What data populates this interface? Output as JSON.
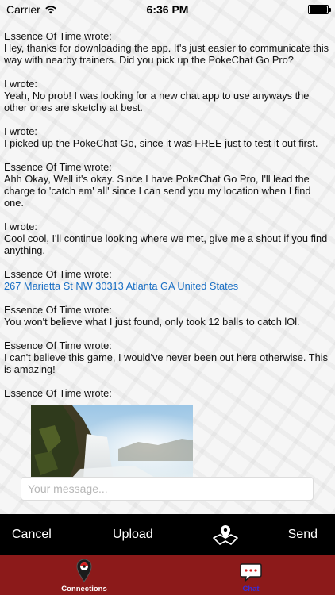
{
  "status_bar": {
    "carrier": "Carrier",
    "time": "6:36 PM"
  },
  "messages": [
    {
      "sender": "Essence Of Time wrote:",
      "text": "Hey, thanks for downloading the app. It's just easier to communicate this way with nearby trainers. Did you pick up the PokeChat Go Pro?"
    },
    {
      "sender": "I wrote:",
      "text": "Yeah, No prob! I was looking for a new chat app to use anyways the other ones are sketchy at best."
    },
    {
      "sender": "I wrote:",
      "text": "I picked up the PokeChat Go, since it was FREE just to test it out first."
    },
    {
      "sender": "Essence Of Time wrote:",
      "text": "Ahh Okay, Well it's okay. Since I have PokeChat Go Pro, I'll lead the charge to 'catch em' all' since I can send you my location when I find one."
    },
    {
      "sender": "I wrote:",
      "text": "Cool cool, I'll continue looking where we met, give me a shout if you find anything."
    },
    {
      "sender": "Essence Of Time wrote:",
      "link": "267 Marietta St NW 30313 Atlanta GA United States"
    },
    {
      "sender": "Essence Of Time wrote:",
      "text": "You won't believe what I just found, only took 12 balls to catch lOl."
    },
    {
      "sender": "Essence Of Time wrote:",
      "text": "I can't believe this game, I would've never been out here otherwise. This is amazing!"
    },
    {
      "sender": "Essence Of Time wrote:",
      "image": "waterfall-photo"
    }
  ],
  "composer": {
    "placeholder": "Your message..."
  },
  "actions": {
    "cancel": "Cancel",
    "upload": "Upload",
    "map_icon": "map-pin-icon",
    "send": "Send"
  },
  "tabs": [
    {
      "label": "Connections",
      "icon": "location-pin-icon"
    },
    {
      "label": "Chat",
      "icon": "chat-bubble-icon",
      "selected": true
    }
  ],
  "colors": {
    "tab_bar": "#8c1a1a",
    "action_bar": "#000000",
    "link": "#1a6fc4",
    "selected_tab_label": "#3a2bd6"
  }
}
